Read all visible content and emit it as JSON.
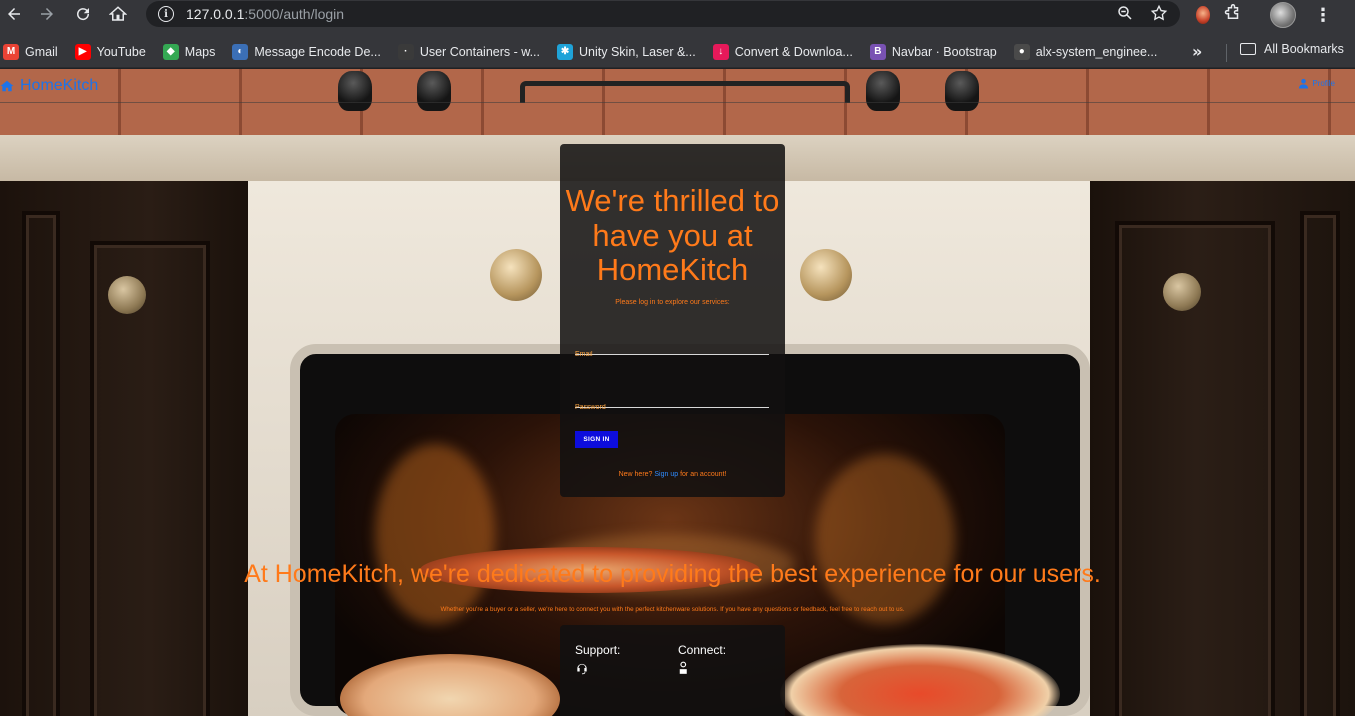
{
  "browser": {
    "url_host": "127.0.0.1",
    "url_rest": ":5000/auth/login",
    "bookmarks": [
      {
        "label": "Gmail",
        "icon": "gmail-icon",
        "color": "#ea4335",
        "glyph": "M"
      },
      {
        "label": "YouTube",
        "icon": "youtube-icon",
        "color": "#ff0000",
        "glyph": "▶"
      },
      {
        "label": "Maps",
        "icon": "maps-icon",
        "color": "#34a853",
        "glyph": "◆"
      },
      {
        "label": "Message Encode De...",
        "icon": "message-encode-icon",
        "color": "#3b6fb6",
        "glyph": "◐"
      },
      {
        "label": "User Containers - w...",
        "icon": "user-containers-icon",
        "color": "#3a3a3a",
        "glyph": "·"
      },
      {
        "label": "Unity Skin, Laser &...",
        "icon": "unity-skin-icon",
        "color": "#1fa3d8",
        "glyph": "✱"
      },
      {
        "label": "Convert & Downloa...",
        "icon": "convert-download-icon",
        "color": "#e6195a",
        "glyph": "↓"
      },
      {
        "label": "Navbar · Bootstrap",
        "icon": "bootstrap-icon",
        "color": "#7952b3",
        "glyph": "B"
      },
      {
        "label": "alx-system_enginee...",
        "icon": "github-icon",
        "color": "#4a4a4a",
        "glyph": "●"
      }
    ],
    "all_bookmarks": "All Bookmarks"
  },
  "app": {
    "brand": "HomeKitch",
    "profile": "Profile",
    "accent": "#ff7a1a",
    "link_color": "#1e73e8"
  },
  "login": {
    "welcome": "We're thrilled to have you at HomeKitch",
    "subtitle": "Please log in to explore our services:",
    "email_placeholder": "Email",
    "password_placeholder": "Password",
    "signin_label": "SIGN IN",
    "new_here": "New here? ",
    "signup_link": "Sign up",
    "signup_suffix": " for an account!"
  },
  "tagline": {
    "title": "At HomeKitch, we're dedicated to providing the best experience for our users.",
    "subtitle": "Whether you're a buyer or a seller, we're here to connect you with the perfect kitchenware solutions. If you have any questions or feedback, feel free to reach out to us."
  },
  "footer": {
    "support": "Support:",
    "connect": "Connect:"
  }
}
